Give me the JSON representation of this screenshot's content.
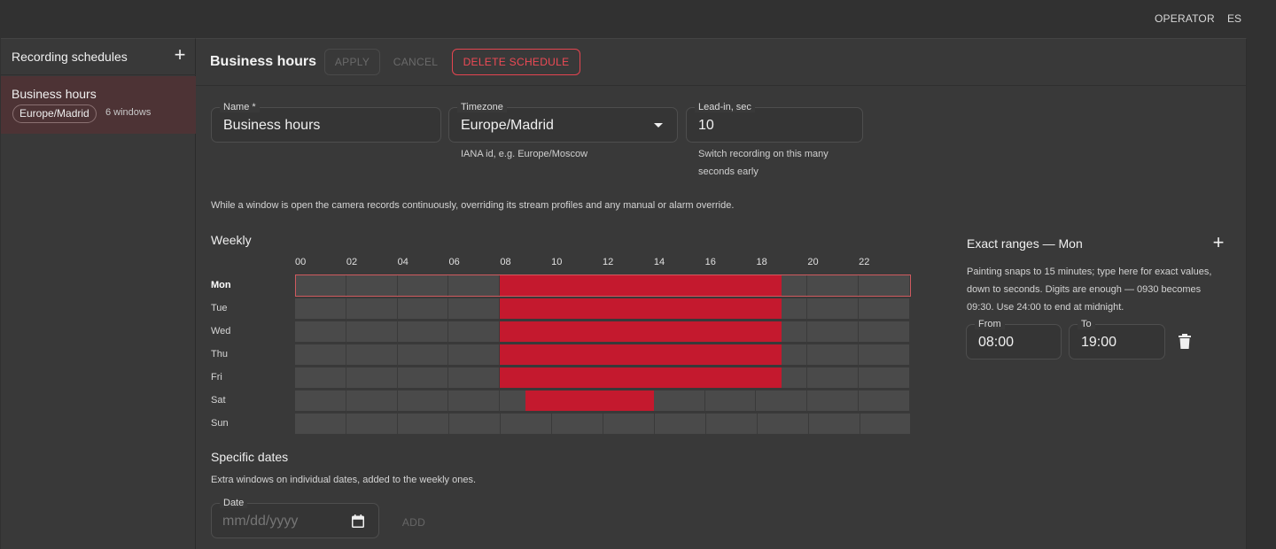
{
  "topbar": {
    "role": "OPERATOR",
    "language": "ES"
  },
  "sidebar": {
    "title": "Recording schedules",
    "add_glyph": "+",
    "items": [
      {
        "name": "Business hours",
        "timezone": "Europe/Madrid",
        "windows": "6 windows"
      }
    ]
  },
  "header": {
    "title": "Business hours",
    "apply_label": "APPLY",
    "cancel_label": "CANCEL",
    "delete_label": "DELETE SCHEDULE"
  },
  "form": {
    "name": {
      "label": "Name *",
      "value": "Business hours"
    },
    "timezone": {
      "label": "Timezone",
      "value": "Europe/Madrid",
      "helper": "IANA id, e.g. Europe/Moscow"
    },
    "leadin": {
      "label": "Lead-in, sec",
      "value": "10",
      "helper_line1": "Switch recording on this many",
      "helper_line2": "seconds early"
    }
  },
  "description": "While a window is open the camera records continuously, overriding its stream profiles and any manual or alarm override.",
  "weekly": {
    "title": "Weekly",
    "hours": [
      "00",
      "02",
      "04",
      "06",
      "08",
      "10",
      "12",
      "14",
      "16",
      "18",
      "20",
      "22"
    ],
    "selected_day": "Mon",
    "days": [
      {
        "label": "Mon",
        "ranges": [
          [
            8,
            19
          ]
        ]
      },
      {
        "label": "Tue",
        "ranges": [
          [
            8,
            19
          ]
        ]
      },
      {
        "label": "Wed",
        "ranges": [
          [
            8,
            19
          ]
        ]
      },
      {
        "label": "Thu",
        "ranges": [
          [
            8,
            19
          ]
        ]
      },
      {
        "label": "Fri",
        "ranges": [
          [
            8,
            19
          ]
        ]
      },
      {
        "label": "Sat",
        "ranges": [
          [
            9,
            14
          ]
        ]
      },
      {
        "label": "Sun",
        "ranges": []
      }
    ]
  },
  "exact_ranges": {
    "title": "Exact ranges — Mon",
    "add_glyph": "+",
    "help": "Painting snaps to 15 minutes; type here for exact values, down to seconds. Digits are enough — 0930 becomes 09:30. Use 24:00 to end at midnight.",
    "from_label": "From",
    "from_value": "08:00",
    "to_label": "To",
    "to_value": "19:00",
    "delete_icon": "trash-icon"
  },
  "specific_dates": {
    "title": "Specific dates",
    "description": "Extra windows on individual dates, added to the weekly ones.",
    "date_label": "Date",
    "date_placeholder": "mm/dd/yyyy",
    "add_label": "ADD"
  },
  "colors": {
    "accent": "#c4192e",
    "danger": "#ee4a55",
    "selected_item_bg": "#4d3335",
    "background": "#313131",
    "panel": "#393939"
  }
}
